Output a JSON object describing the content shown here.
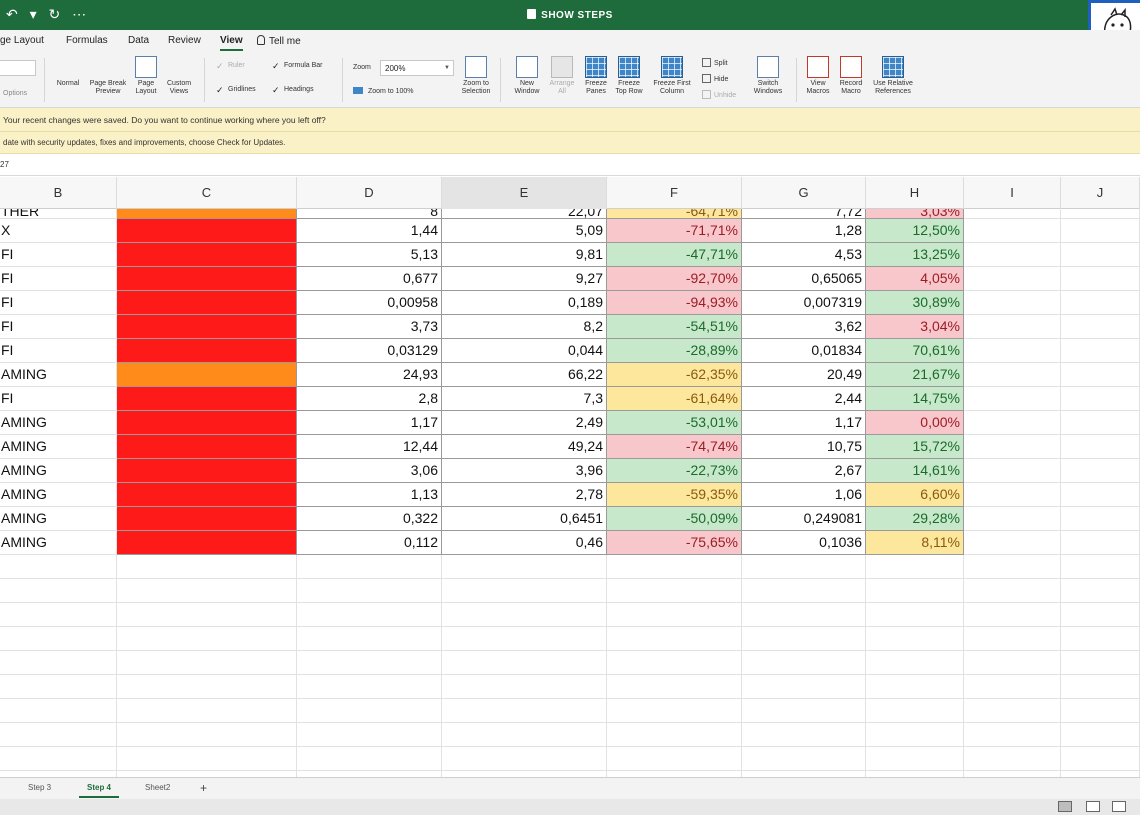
{
  "app": {
    "title": "SHOW STEPS"
  },
  "tabs": [
    {
      "label": "ge Layout"
    },
    {
      "label": "Formulas"
    },
    {
      "label": "Data"
    },
    {
      "label": "Review"
    },
    {
      "label": "View"
    },
    {
      "label": "Tell me"
    }
  ],
  "ribbon": {
    "left_partial": "Options",
    "views": [
      {
        "label": "Normal"
      },
      {
        "label": "Page Break Preview"
      },
      {
        "label": "Page Layout"
      },
      {
        "label": "Custom Views"
      }
    ],
    "checks": [
      {
        "label": "Ruler",
        "checked": true,
        "disabled": true
      },
      {
        "label": "Formula Bar",
        "checked": true,
        "disabled": false
      },
      {
        "label": "Gridlines",
        "checked": true,
        "disabled": false
      },
      {
        "label": "Headings",
        "checked": true,
        "disabled": false
      }
    ],
    "zoom_label": "Zoom",
    "zoom_value": "200%",
    "zoom_100": "Zoom to 100%",
    "buttons": [
      {
        "label": "Zoom to Selection"
      },
      {
        "label": "New Window"
      },
      {
        "label": "Arrange All"
      },
      {
        "label": "Freeze Panes"
      },
      {
        "label": "Freeze Top Row"
      },
      {
        "label": "Freeze First Column"
      }
    ],
    "small": [
      {
        "label": "Split"
      },
      {
        "label": "Hide"
      },
      {
        "label": "Unhide"
      }
    ],
    "switch_windows": "Switch Windows",
    "macros": [
      {
        "label": "View Macros"
      },
      {
        "label": "Record Macro"
      },
      {
        "label": "Use Relative References"
      }
    ]
  },
  "messages": {
    "recover": "Your recent changes were saved. Do you want to continue working where you left off?",
    "update": "date with security updates, fixes and improvements, choose Check for Updates."
  },
  "namebox": "27",
  "columns": [
    "B",
    "C",
    "D",
    "E",
    "F",
    "G",
    "H",
    "I",
    "J"
  ],
  "top_partial": {
    "b": "THER",
    "d": "8",
    "e": "22,07",
    "f": "-64,71%",
    "g": "7,72",
    "h": "3,03%"
  },
  "rows": [
    {
      "b": "X",
      "c_fill": "red",
      "d": "1,44",
      "e": "5,09",
      "f": "-71,71%",
      "f_style": "neg-red",
      "g": "1,28",
      "h": "12,50%",
      "h_style": "pos-green"
    },
    {
      "b": "FI",
      "c_fill": "red",
      "d": "5,13",
      "e": "9,81",
      "f": "-47,71%",
      "f_style": "neg-green",
      "g": "4,53",
      "h": "13,25%",
      "h_style": "pos-green"
    },
    {
      "b": "FI",
      "c_fill": "red",
      "d": "0,677",
      "e": "9,27",
      "f": "-92,70%",
      "f_style": "neg-red",
      "g": "0,65065",
      "h": "4,05%",
      "h_style": "pos-red"
    },
    {
      "b": "FI",
      "c_fill": "red",
      "d": "0,00958",
      "e": "0,189",
      "f": "-94,93%",
      "f_style": "neg-red",
      "g": "0,007319",
      "h": "30,89%",
      "h_style": "pos-green"
    },
    {
      "b": "FI",
      "c_fill": "red",
      "d": "3,73",
      "e": "8,2",
      "f": "-54,51%",
      "f_style": "neg-green",
      "g": "3,62",
      "h": "3,04%",
      "h_style": "pos-red"
    },
    {
      "b": "FI",
      "c_fill": "red",
      "d": "0,03129",
      "e": "0,044",
      "f": "-28,89%",
      "f_style": "neg-green",
      "g": "0,01834",
      "h": "70,61%",
      "h_style": "pos-green"
    },
    {
      "b": "AMING",
      "c_fill": "orange",
      "d": "24,93",
      "e": "66,22",
      "f": "-62,35%",
      "f_style": "neg-yellow",
      "g": "20,49",
      "h": "21,67%",
      "h_style": "pos-green"
    },
    {
      "b": "FI",
      "c_fill": "red",
      "d": "2,8",
      "e": "7,3",
      "f": "-61,64%",
      "f_style": "neg-yellow",
      "g": "2,44",
      "h": "14,75%",
      "h_style": "pos-green"
    },
    {
      "b": "AMING",
      "c_fill": "red",
      "d": "1,17",
      "e": "2,49",
      "f": "-53,01%",
      "f_style": "neg-green",
      "g": "1,17",
      "h": "0,00%",
      "h_style": "pos-red"
    },
    {
      "b": "AMING",
      "c_fill": "red",
      "d": "12,44",
      "e": "49,24",
      "f": "-74,74%",
      "f_style": "neg-red",
      "g": "10,75",
      "h": "15,72%",
      "h_style": "pos-green"
    },
    {
      "b": "AMING",
      "c_fill": "red",
      "d": "3,06",
      "e": "3,96",
      "f": "-22,73%",
      "f_style": "neg-green",
      "g": "2,67",
      "h": "14,61%",
      "h_style": "pos-green"
    },
    {
      "b": "AMING",
      "c_fill": "red",
      "d": "1,13",
      "e": "2,78",
      "f": "-59,35%",
      "f_style": "neg-yellow",
      "g": "1,06",
      "h": "6,60%",
      "h_style": "pos-yellow"
    },
    {
      "b": "AMING",
      "c_fill": "red",
      "d": "0,322",
      "e": "0,6451",
      "f": "-50,09%",
      "f_style": "neg-green",
      "g": "0,249081",
      "h": "29,28%",
      "h_style": "pos-green"
    },
    {
      "b": "AMING",
      "c_fill": "red",
      "d": "0,112",
      "e": "0,46",
      "f": "-75,65%",
      "f_style": "neg-red",
      "g": "0,1036",
      "h": "8,11%",
      "h_style": "pos-yellow"
    }
  ],
  "sheet_tabs": [
    {
      "label": "Step 3"
    },
    {
      "label": "Step 4",
      "active": true
    },
    {
      "label": "Sheet2"
    }
  ],
  "add_sheet": "+",
  "colors": {
    "brand": "#1e6b3c",
    "fill_red": "#ff1a1a",
    "fill_orange": "#ff8c1a",
    "message_bar": "#fbf1c7"
  }
}
